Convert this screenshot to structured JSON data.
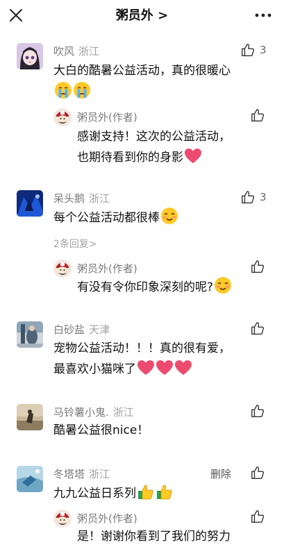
{
  "header": {
    "title": "粥员外 >"
  },
  "comments": [
    {
      "name": "吹风",
      "location": "浙江",
      "likes": "3",
      "text": "大白的酷暑公益活动，真的很暖心",
      "reply": {
        "name": "粥员外(作者)",
        "line1": "感谢支持！这次的公益活动，",
        "line2": "也期待看到你的身影"
      }
    },
    {
      "name": "呆头鹅",
      "location": "浙江",
      "likes": "3",
      "text": "每个公益活动都很棒",
      "more_replies": "2条回复>",
      "reply": {
        "name": "粥员外(作者)",
        "line1": "有没有令你印象深刻的呢?"
      }
    },
    {
      "name": "白砂盐",
      "location": "天津",
      "line1": "宠物公益活动！！！真的很有爱，",
      "line2": "最喜欢小猫咪了"
    },
    {
      "name": "马铃薯小鬼.",
      "location": "浙江",
      "text": "酷暑公益很nice！"
    },
    {
      "name": "冬塔塔",
      "location": "浙江",
      "delete_label": "删除",
      "text": "九九公益日系列",
      "reply": {
        "name": "粥员外(作者)",
        "line1": "是！谢谢你看到了我们的努力"
      }
    }
  ]
}
